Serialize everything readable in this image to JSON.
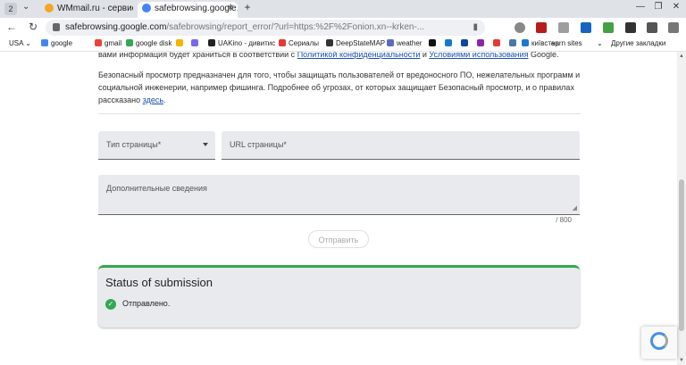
{
  "tabs": {
    "count": "2",
    "inactive_title": "WMmail.ru - сервис почт",
    "active_title": "safebrowsing.google.co",
    "new_tab": "+"
  },
  "window_controls": {
    "minimize": "—",
    "maximize": "❐",
    "close": "✕"
  },
  "nav": {
    "back": "←",
    "reload": "↻"
  },
  "address": {
    "host": "safebrowsing.google.com",
    "path": "/safebrowsing/report_error/?url=https:%2F%2Fonion.xn--krken-..."
  },
  "bookmarks": [
    {
      "label": "USA",
      "color": "#ffffff"
    },
    {
      "label": "google",
      "color": "#4285f4"
    },
    {
      "label": "gmail",
      "color": "#ea4335"
    },
    {
      "label": "google disk",
      "color": "#34a853"
    },
    {
      "label": "",
      "color": "#f4b400"
    },
    {
      "label": "",
      "color": "#7b68ee"
    },
    {
      "label": "UAKino - дивитис",
      "color": "#222222"
    },
    {
      "label": "Сериалы",
      "color": "#e53935"
    },
    {
      "label": "DeepStateMAP",
      "color": "#333333"
    },
    {
      "label": "weather",
      "color": "#5c6bc0"
    },
    {
      "label": "",
      "color": "#111111"
    },
    {
      "label": "",
      "color": "#1976d2"
    },
    {
      "label": "",
      "color": "#0d47a1"
    },
    {
      "label": "",
      "color": "#8e24aa"
    },
    {
      "label": "",
      "color": "#e53935"
    },
    {
      "label": "",
      "color": "#4a76a8"
    },
    {
      "label": "київстар",
      "color": "#1976d2"
    },
    {
      "label": "earn sites",
      "color": "#ffffff"
    }
  ],
  "other_bookmarks": "Другие закладки",
  "content": {
    "p1_pre": "вами информация будет храниться в соответствии с ",
    "privacy_link": "Политикой конфиденциальности",
    "p1_and": " и ",
    "terms_link": "Условиями использования",
    "p1_post": " Google.",
    "p2_text": "Безопасный просмотр предназначен для того, чтобы защищать пользователей от вредоносного ПО, нежелательных программ и социальной инженерии, например фишинга. Подробнее об угрозах, от которых защищает Безопасный просмотр, и о правилах рассказано ",
    "here_link": "здесь",
    "p2_end": ".",
    "page_type_label": "Тип страницы*",
    "url_label": "URL страницы*",
    "details_label": "Дополнительные сведения",
    "counter": "/ 800",
    "submit_label": "Отправить",
    "status_title": "Status of submission",
    "status_message": "Отправлено.",
    "check_icon": "✓"
  },
  "colors": {
    "accent_green": "#34a853",
    "link": "#1a4fb0"
  }
}
